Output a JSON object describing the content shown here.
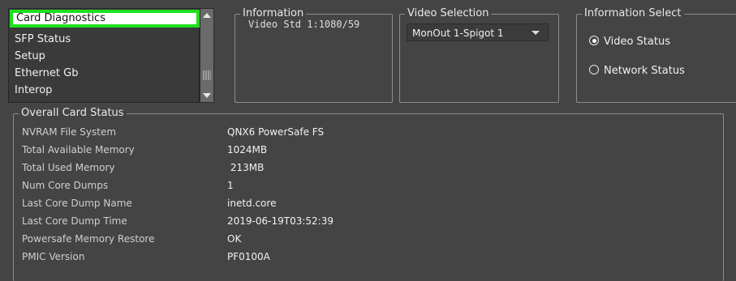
{
  "nav": {
    "items": [
      {
        "label": "Card Diagnostics"
      },
      {
        "label": "SFP Status"
      },
      {
        "label": "Setup"
      },
      {
        "label": "Ethernet Gb"
      },
      {
        "label": "Interop"
      }
    ],
    "selected_index": 0,
    "highlight_color": "#1ee01e"
  },
  "information": {
    "title": "Information",
    "text": "Video Std 1:1080/59"
  },
  "video_selection": {
    "title": "Video Selection",
    "selected": "MonOut 1-Spigot 1"
  },
  "information_select": {
    "title": "Information Select",
    "options": [
      {
        "label": "Video Status",
        "selected": true
      },
      {
        "label": "Network Status",
        "selected": false
      }
    ]
  },
  "overall_status": {
    "title": "Overall Card Status",
    "rows": [
      {
        "label": "NVRAM File System",
        "value": "QNX6 PowerSafe FS"
      },
      {
        "label": "Total Available Memory",
        "value": "1024MB"
      },
      {
        "label": "Total Used Memory",
        "value": " 213MB"
      },
      {
        "label": "Num Core Dumps",
        "value": "1"
      },
      {
        "label": "Last Core Dump Name",
        "value": "inetd.core"
      },
      {
        "label": "Last Core Dump Time",
        "value": "2019-06-19T03:52:39"
      },
      {
        "label": "Powersafe Memory Restore",
        "value": "OK"
      },
      {
        "label": "PMIC Version",
        "value": "PF0100A"
      }
    ]
  }
}
